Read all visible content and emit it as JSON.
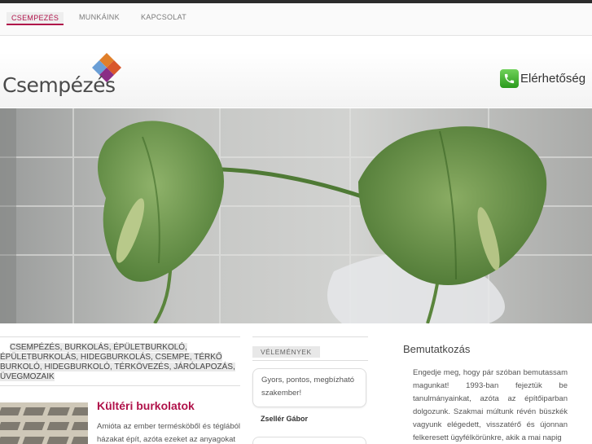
{
  "nav": {
    "items": [
      {
        "label": "CSEMPEZÉS"
      },
      {
        "label": "MUNKÁINK"
      },
      {
        "label": "KAPCSOLAT"
      }
    ]
  },
  "header": {
    "brand": "Csempézés",
    "contact_label": "Elérhetőség"
  },
  "tags": {
    "line1": "CSEMPÉZÉS, BURKOLÁS, ÉPÜLETBURKOLÓ,",
    "line2": "ÉPÜLETBURKOLÁS, HIDEGBURKOLÁS, CSEMPE, TÉRKŐ",
    "line3": "BURKOLÓ, HIDEGBURKOLÓ, TÉRKÖVEZÉS, JÁRÓLAPOZÁS,",
    "line4": "ÜVEGMOZAIK"
  },
  "article": {
    "title": "Kültéri burkolatok",
    "text": "Amióta az ember termésköből és téglából házakat épít, azóta ezeket az anyagokat"
  },
  "reviews": {
    "heading": "VÉLEMÉNYEK",
    "quote": "Gyors, pontos, megbízható szakember!",
    "author": "Zsellér Gábor"
  },
  "intro": {
    "title": "Bemutatkozás",
    "text": "Engedje meg, hogy pár szóban bemutassam magunkat! 1993-ban fejeztük be tanulmányainkat, azóta az építőiparban dolgozunk. Szakmai múltunk révén büszkék vagyunk elégedett, visszatérő és újonnan felkeresett ügyfélkörünkre, akik a mai napig"
  },
  "colors": {
    "accent": "#b0124a",
    "phone_green": "#3fb02c"
  },
  "icons": [
    "logo-diamond-icon",
    "phone-icon"
  ]
}
